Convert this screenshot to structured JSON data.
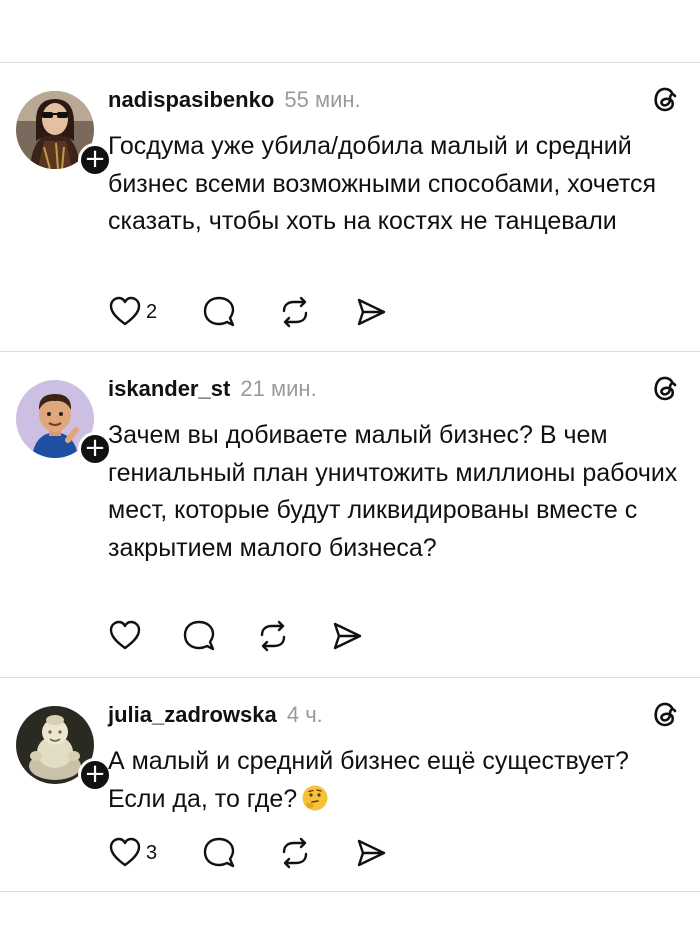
{
  "posts": [
    {
      "username": "nadispasibenko",
      "time": "55 мин.",
      "text": "Госдума уже убила/добила малый и средний бизнес всеми возможными способами, хочется сказать, чтобы хоть на костях не танцевали",
      "likes": "2",
      "avatar": "woman-with-sunglasses",
      "follow_icon": "plus-icon"
    },
    {
      "username": "iskander_st",
      "time": "21 мин.",
      "text": "Зачем вы добиваете малый бизнес? В чем гениальный план уничтожить миллионы рабочих мест, которые будут ликвидированы вместе с закрытием малого бизнеса?",
      "likes": "",
      "avatar": "cartoon-man-avatar",
      "follow_icon": "plus-icon"
    },
    {
      "username": "julia_zadrowska",
      "time": "4 ч.",
      "text": "А малый и средний бизнес ещё существует? Если да, то где?",
      "likes": "3",
      "avatar": "figurine-photo",
      "follow_icon": "plus-icon",
      "emoji": "thinking-face"
    }
  ],
  "icons": {
    "like": "heart-icon",
    "reply": "comment-icon",
    "repost": "repost-icon",
    "share": "send-icon",
    "brand": "threads-logo-icon"
  }
}
